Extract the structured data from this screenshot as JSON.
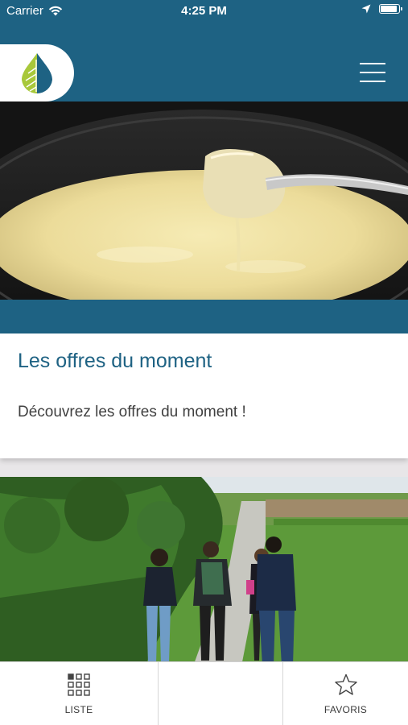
{
  "status_bar": {
    "carrier": "Carrier",
    "time": "4:25 PM",
    "icons": [
      "wifi-icon",
      "location-arrow-icon",
      "battery-icon"
    ]
  },
  "header": {
    "logo": "leaf-drop-logo",
    "menu_icon": "hamburger-menu-icon",
    "background_color": "#1e6283"
  },
  "offers_card": {
    "title": "Les offres du moment",
    "description": "Découvrez les offres du moment !"
  },
  "images": {
    "hero_top": "fondue-cheese-photo",
    "hero_bottom": "hikers-on-trail-photo"
  },
  "tab_bar": {
    "tabs": [
      {
        "label": "LISTE",
        "icon": "grid-icon"
      },
      {
        "label": "",
        "icon": ""
      },
      {
        "label": "FAVORIS",
        "icon": "star-icon"
      }
    ]
  },
  "colors": {
    "brand": "#1e6283",
    "title_text": "#1e6283",
    "body_text": "#404040"
  }
}
